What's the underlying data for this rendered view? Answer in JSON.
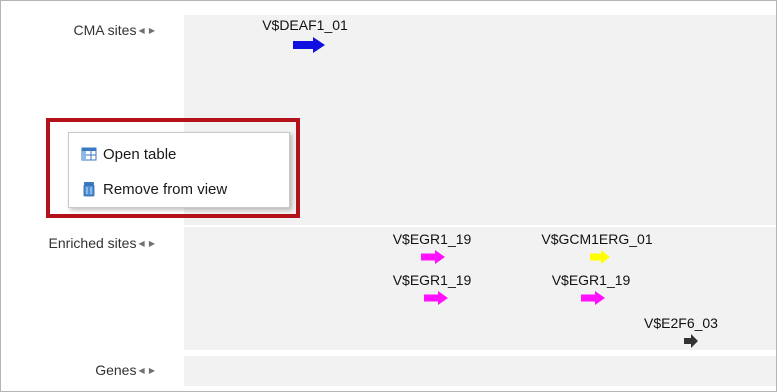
{
  "tracks": [
    {
      "name": "CMA sites",
      "nav": "◀ ▶"
    },
    {
      "name": "Enriched sites",
      "nav": "◀ ▶"
    },
    {
      "name": "Genes",
      "nav": "◀ ▶"
    }
  ],
  "sites": [
    {
      "label": "V$DEAF1_01",
      "color": "#1010e0",
      "icon": "right-arrow-icon"
    },
    {
      "label": "V$EGR1_19",
      "color": "#ff10ff",
      "icon": "right-arrow-icon"
    },
    {
      "label": "V$GCM1ERG_01",
      "color": "#ffff00",
      "icon": "right-arrow-icon"
    },
    {
      "label": "V$EGR1_19",
      "color": "#ff10ff",
      "icon": "right-arrow-icon"
    },
    {
      "label": "V$EGR1_19",
      "color": "#ff10ff",
      "icon": "right-arrow-icon"
    },
    {
      "label": "V$E2F6_03",
      "color": "#333333",
      "icon": "right-arrow-icon"
    }
  ],
  "context_menu": {
    "items": [
      {
        "label": "Open table",
        "icon": "table-icon"
      },
      {
        "label": "Remove from view",
        "icon": "trash-icon"
      }
    ],
    "highlight_color": "#b3121b"
  },
  "colors": {
    "track_background": "#f2f2f2",
    "border": "#b5b5b5"
  }
}
